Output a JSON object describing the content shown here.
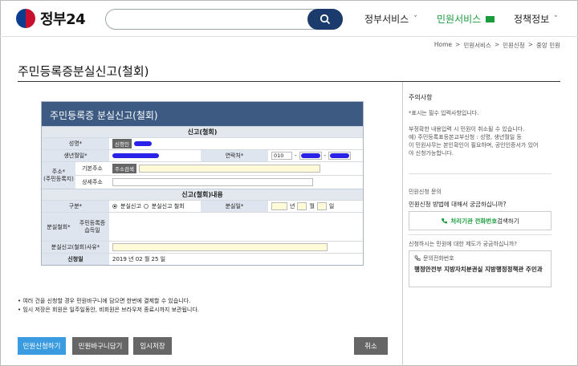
{
  "header": {
    "logo_text": "정부24",
    "search_placeholder": "",
    "nav": [
      {
        "label": "정부서비스",
        "active": false
      },
      {
        "label": "민원서비스",
        "active": true
      },
      {
        "label": "정책정보",
        "active": false
      }
    ]
  },
  "breadcrumb": [
    "Home",
    ">",
    "민원서비스",
    ">",
    "민원신청",
    ">",
    "중앙 민원"
  ],
  "page": {
    "title": "주민등록증분실신고(철회)"
  },
  "form": {
    "title": "주민등록증 분실신고(철회)",
    "section1": "신고(철회)",
    "name_label": "성명*",
    "name_btn": "신청인",
    "birth_label": "생년월일*",
    "phone_label": "연락처*",
    "phone_prefix": "010",
    "phone_dash1": "-",
    "phone_dash2": "-",
    "addr_label": "주소*\n(주민등록지)",
    "addr_basic_label": "기본주소",
    "addr_btn": "주소검색",
    "addr_detail_label": "상세주소",
    "section2": "신고(철회)내용",
    "type_label": "구분*",
    "type_opt1": "분실신고",
    "type_opt2": "분실신고 철회",
    "lost_date_label": "분실일*",
    "year": "년",
    "month": "월",
    "day": "일",
    "withdraw_label": "분실철회*",
    "idcard_label": "주민등록증\n습득일",
    "reason_label": "분실신고(철회)사유*",
    "apply_date_label": "신청일",
    "apply_date_value": "2019 년 02 월 25 일"
  },
  "notes": [
    "• 여러 건을 신청할 경우 민원바구니에 담으면 한번에 결제할 수 있습니다.",
    "• 임시 저장은 회원은 일주일동안, 비회원은 브라우저 종료시까지 보관됩니다."
  ],
  "buttons": {
    "apply": "민원신청하기",
    "basket": "민원바구니담기",
    "temp_save": "임시저장",
    "cancel": "취소"
  },
  "right": {
    "caution_title": "주의사항",
    "caution_lines": [
      "*표시는 필수 입력사항입니다.",
      "",
      "부정확한 내용입력 시 민원이 취소될 수 있습니다.",
      "예) 주민등록표등본교부신청 : 성명, 생년월일 등",
      "이 민원사무는 본인확인이 필요하며, 공인인증서가 있어",
      "야 신청가능합니다."
    ],
    "inquiry_title": "민원신청 문의",
    "inquiry_question": "민원신청 방법에 대해서 궁금하십니까?",
    "inquiry_link_bold": "처리기관 전화번호",
    "inquiry_link_rest": " 검색하기",
    "system_question": "신청하시는 민원에 대한 제도가 궁금하십니까?",
    "phone_label": "문의전화번호",
    "dept": "행정안전부 지방자치분권실 지방행정정책관 주민과"
  },
  "colors": {
    "header_blue": "#1a3b6b",
    "form_head": "#3c5a82",
    "green": "#1a9b3c",
    "apply_btn": "#3b9be0",
    "gray_btn": "#666666"
  }
}
